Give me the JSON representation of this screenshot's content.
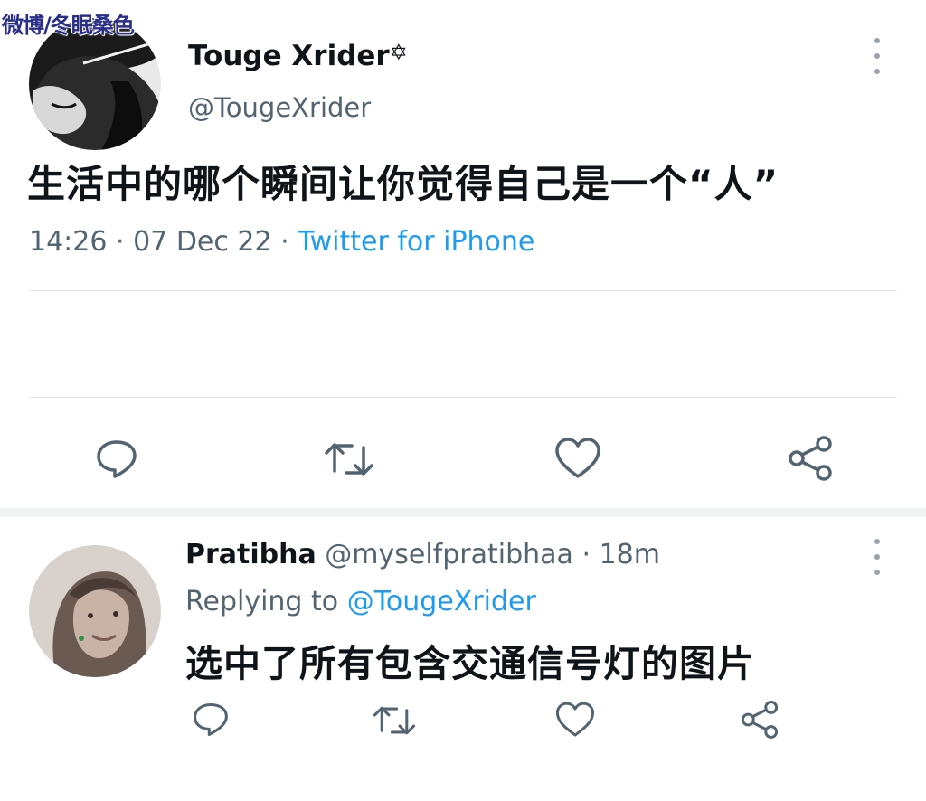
{
  "watermark": "微博/冬眠桑色",
  "main_tweet": {
    "author_name": "Touge Xrider",
    "author_badge": "✡",
    "author_handle": "@TougeXrider",
    "text": "生活中的哪个瞬间让你觉得自己是一个“人”",
    "time": "14:26",
    "date": "07 Dec 22",
    "separator": "·",
    "source": "Twitter for iPhone",
    "actions": [
      "reply-icon",
      "retweet-icon",
      "like-icon",
      "share-icon"
    ]
  },
  "reply_tweet": {
    "author_name": "Pratibha",
    "author_handle": "@myselfpratibhaa",
    "separator": "·",
    "age": "18m",
    "replying_label": "Replying to",
    "replying_to": "@TougeXrider",
    "text": "选中了所有包含交通信号灯的图片",
    "actions": [
      "reply-icon",
      "retweet-icon",
      "like-icon",
      "share-icon"
    ]
  },
  "colors": {
    "text_primary": "#0f1419",
    "text_secondary": "#536471",
    "link": "#1d9bf0",
    "icon": "#536471",
    "divider": "#e6e9eb"
  }
}
